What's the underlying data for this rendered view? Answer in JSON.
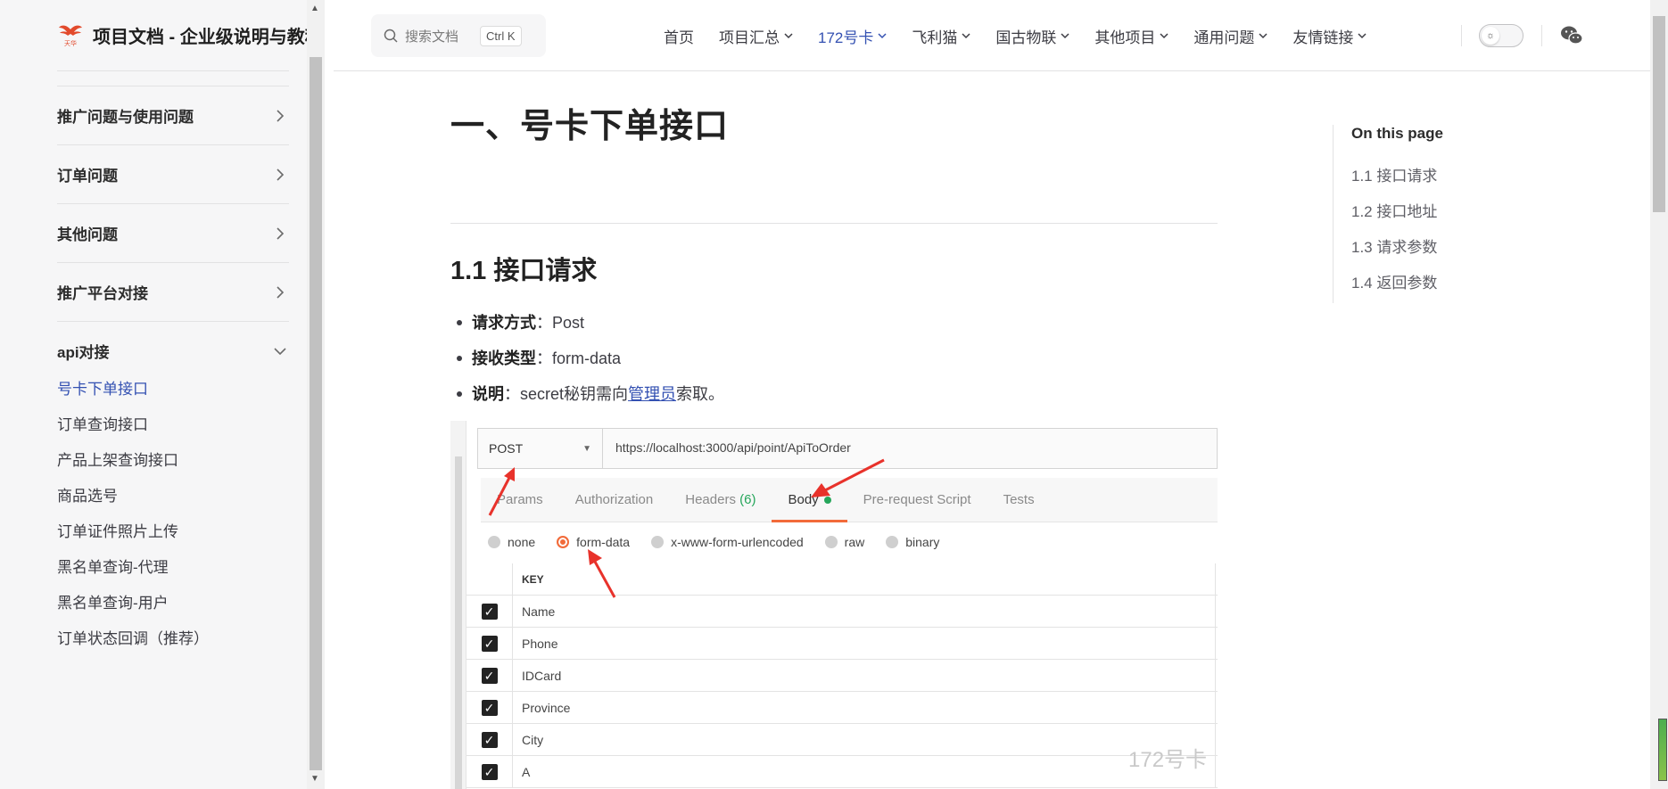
{
  "brand": {
    "title": "项目文档 - 企业级说明与教程"
  },
  "sidebar": {
    "groups": [
      {
        "label": "推广问题与使用问题"
      },
      {
        "label": "订单问题"
      },
      {
        "label": "其他问题"
      },
      {
        "label": "推广平台对接"
      },
      {
        "label": "api对接"
      }
    ],
    "links": [
      {
        "label": "号卡下单接口",
        "active": true
      },
      {
        "label": "订单查询接口"
      },
      {
        "label": "产品上架查询接口"
      },
      {
        "label": "商品选号"
      },
      {
        "label": "订单证件照片上传"
      },
      {
        "label": "黑名单查询-代理"
      },
      {
        "label": "黑名单查询-用户"
      },
      {
        "label": "订单状态回调（推荐）"
      }
    ]
  },
  "search": {
    "placeholder": "搜索文档",
    "shortcut": "Ctrl K"
  },
  "nav": {
    "items": [
      {
        "label": "首页"
      },
      {
        "label": "项目汇总"
      },
      {
        "label": "172号卡"
      },
      {
        "label": "飞利猫"
      },
      {
        "label": "国古物联"
      },
      {
        "label": "其他项目"
      },
      {
        "label": "通用问题"
      },
      {
        "label": "友情链接"
      }
    ]
  },
  "content": {
    "h1": "一、号卡下单接口",
    "h2": "1.1 接口请求",
    "bullets": [
      {
        "label": "请求方式",
        "sep": "：",
        "value": "Post"
      },
      {
        "label": "接收类型",
        "sep": "：",
        "value": "form-data"
      },
      {
        "label": "说明",
        "sep": "：",
        "value": "secret秘钥需向",
        "link": "管理员",
        "tail": "索取。"
      }
    ]
  },
  "postman": {
    "method": "POST",
    "url": "https://localhost:3000/api/point/ApiToOrder",
    "tabs": {
      "params": "Params",
      "authorization": "Authorization",
      "headers": "Headers",
      "headers_count": "(6)",
      "body": "Body",
      "prerequest": "Pre-request Script",
      "tests": "Tests"
    },
    "body_types": {
      "none": "none",
      "form_data": "form-data",
      "urlencoded": "x-www-form-urlencoded",
      "raw": "raw",
      "binary": "binary"
    },
    "key_header": "KEY",
    "keys": [
      "Name",
      "Phone",
      "IDCard",
      "Province",
      "City",
      "A"
    ],
    "watermark": "172号卡"
  },
  "toc": {
    "title": "On this page",
    "items": [
      "1.1 接口请求",
      "1.2 接口地址",
      "1.3 请求参数",
      "1.4 返回参数"
    ]
  },
  "colors": {
    "accent": "#3451b2",
    "postman_orange": "#f26b3a",
    "arrow_red": "#e8322b"
  }
}
